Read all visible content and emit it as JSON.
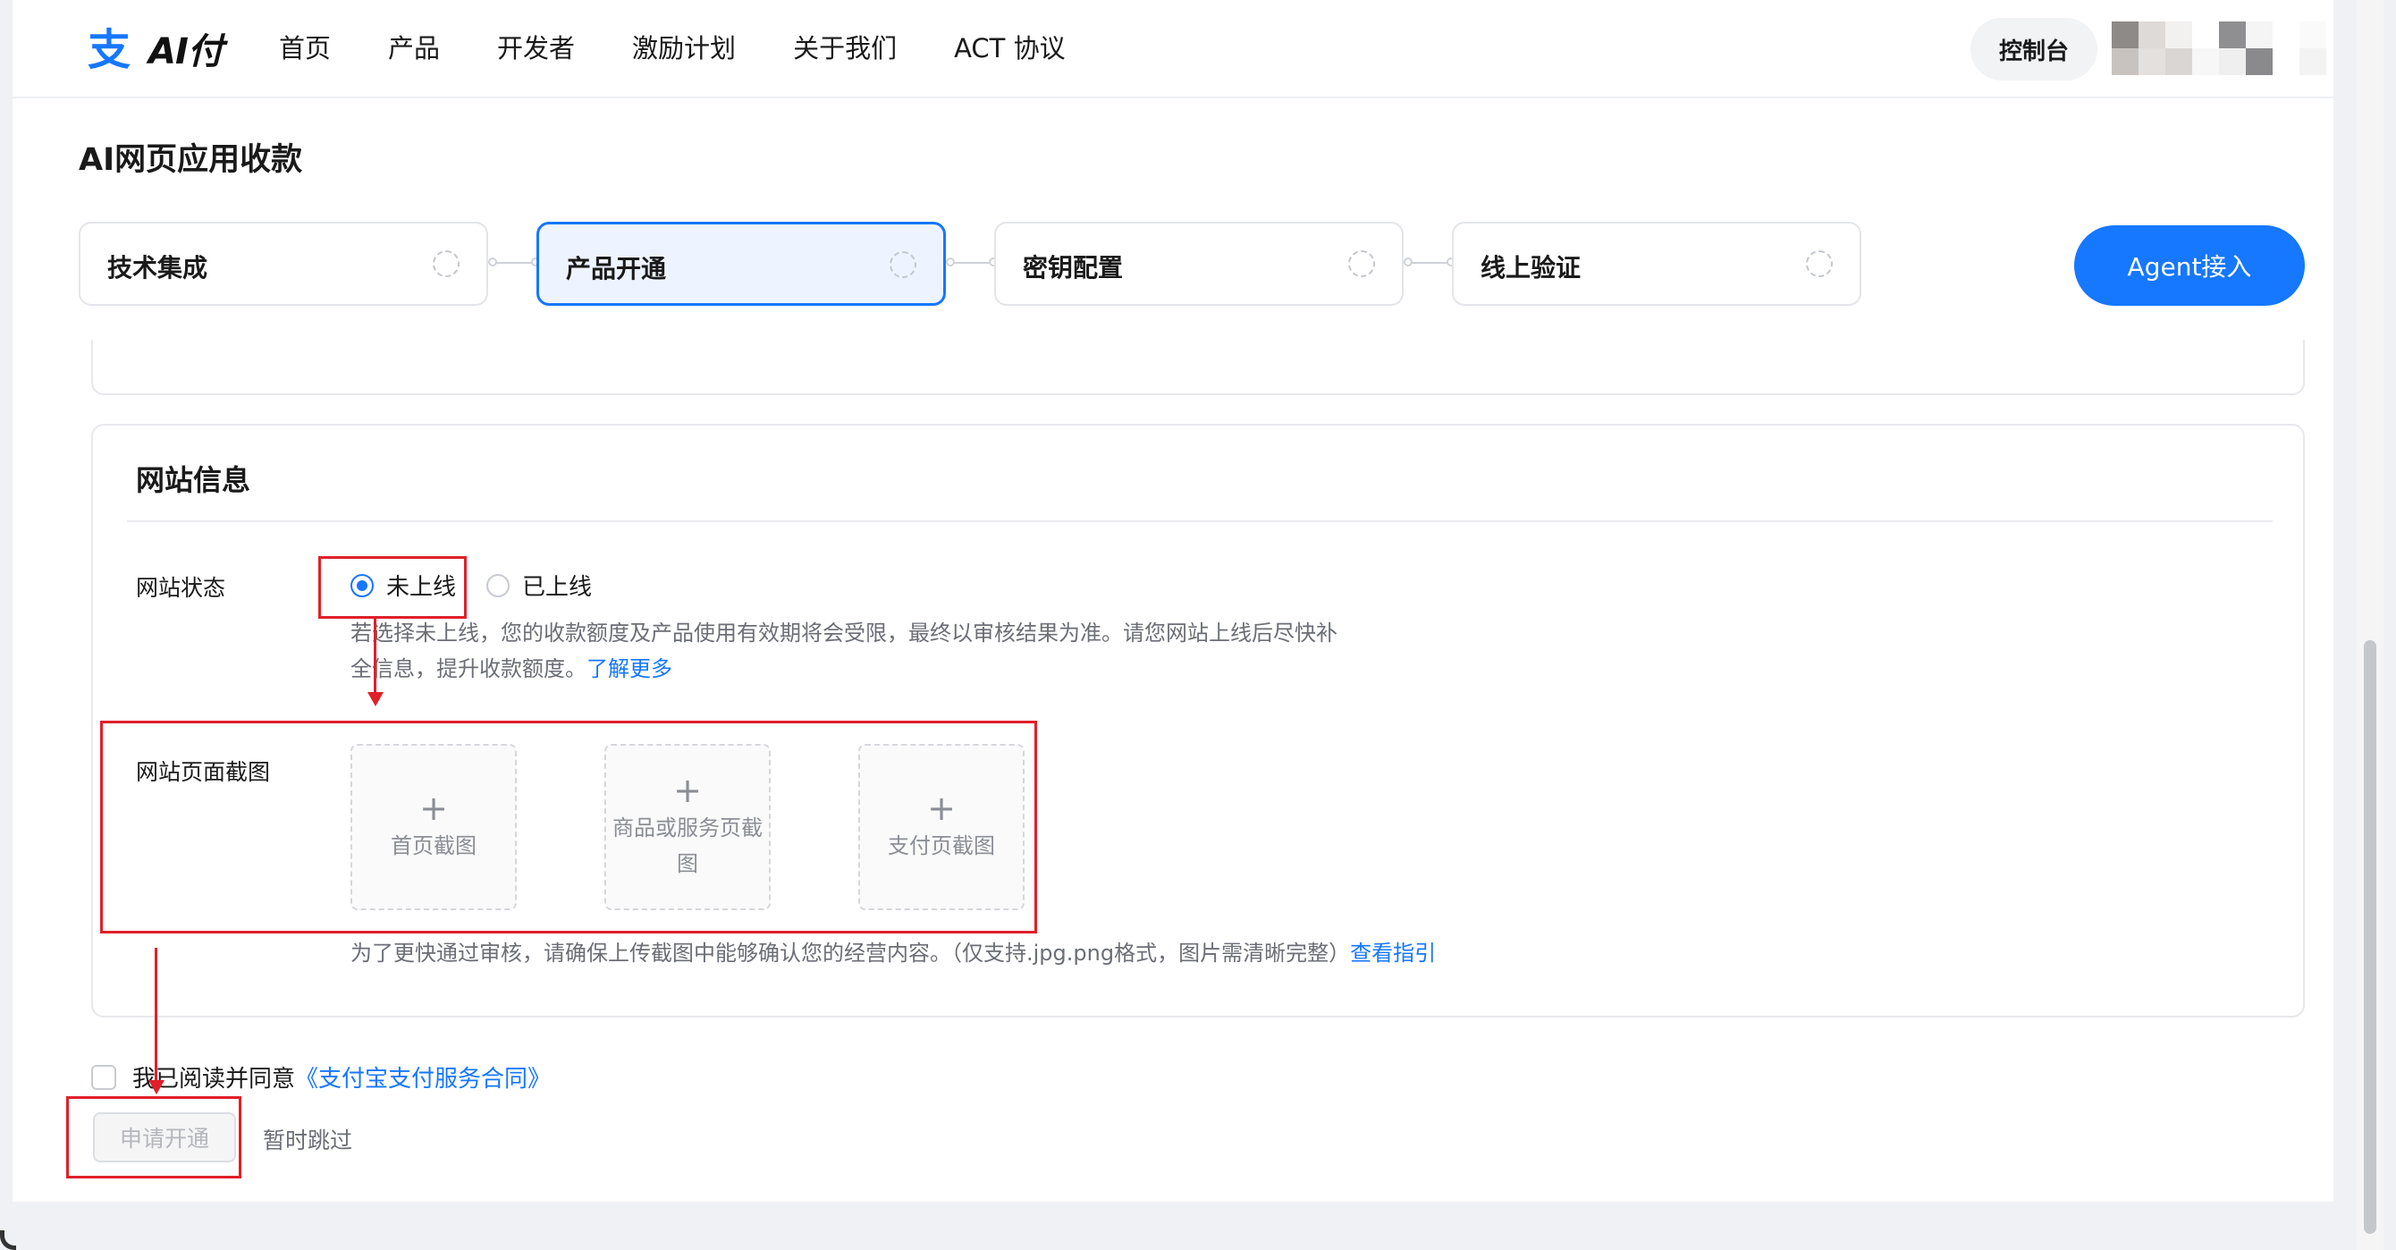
{
  "brand": {
    "logo_glyph": "支",
    "logo_text": "AI付",
    "logo_color": "#1677ff"
  },
  "nav": {
    "links": [
      "首页",
      "产品",
      "开发者",
      "激励计划",
      "关于我们",
      "ACT 协议"
    ],
    "console_label": "控制台"
  },
  "page": {
    "title": "AI网页应用收款"
  },
  "steps": [
    {
      "label": "技术集成",
      "active": false
    },
    {
      "label": "产品开通",
      "active": true
    },
    {
      "label": "密钥配置",
      "active": false
    },
    {
      "label": "线上验证",
      "active": false
    }
  ],
  "agent_button": "Agent接入",
  "website_info": {
    "title": "网站信息",
    "status_label": "网站状态",
    "status_options": [
      {
        "label": "未上线",
        "checked": true
      },
      {
        "label": "已上线",
        "checked": false
      }
    ],
    "status_hint_line1": "若选择未上线，您的收款额度及产品使用有效期将会受限，最终以审核结果为准。请您网站上线后尽快补",
    "status_hint_line2": "全信息，提升收款额度。",
    "status_hint_link": "了解更多",
    "screenshot_label": "网站页面截图",
    "uploads": [
      "首页截图",
      "商品或服务页截图",
      "支付页截图"
    ],
    "upload_plus": "+",
    "upload_hint": "为了更快通过审核，请确保上传截图中能够确认您的经营内容。（仅支持.jpg.png格式，图片需清晰完整）",
    "upload_hint_link": "查看指引"
  },
  "agreement": {
    "text": "我已阅读并同意",
    "link": "《支付宝支付服务合同》",
    "checked": false
  },
  "actions": {
    "apply": "申请开通",
    "skip": "暂时跳过"
  },
  "colors": {
    "accent": "#1677ff",
    "annotation": "#e0202a"
  }
}
